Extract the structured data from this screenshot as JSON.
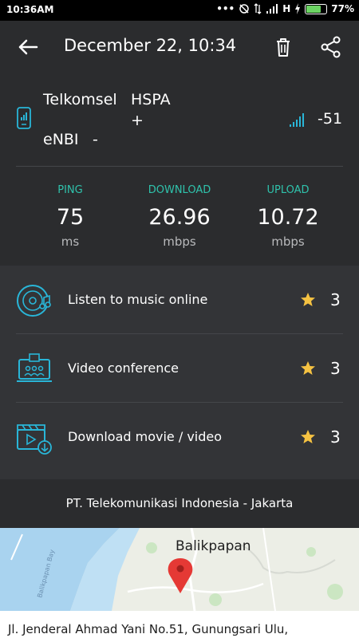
{
  "status_bar": {
    "time": "10:36AM",
    "network_type": "H",
    "battery_percent": "77%",
    "battery_level": 0.77
  },
  "header": {
    "title": "December 22, 10:34"
  },
  "network": {
    "carrier": "Telkomsel",
    "type": "HSPA",
    "plus": "+",
    "cell": "eNBI",
    "cell_value": "-",
    "signal": "-51"
  },
  "metrics": {
    "ping": {
      "label": "PING",
      "value": "75",
      "unit": "ms"
    },
    "download": {
      "label": "DOWNLOAD",
      "value": "26.96",
      "unit": "mbps"
    },
    "upload": {
      "label": "UPLOAD",
      "value": "10.72",
      "unit": "mbps"
    }
  },
  "activities": [
    {
      "label": "Listen to music online",
      "rating": "3",
      "icon": "music-disc-icon"
    },
    {
      "label": "Video conference",
      "rating": "3",
      "icon": "video-conference-icon"
    },
    {
      "label": "Download movie / video",
      "rating": "3",
      "icon": "download-video-icon"
    }
  ],
  "isp": "PT. Telekomunikasi Indonesia - Jakarta",
  "map": {
    "city": "Balikpapan",
    "bay_label": "Balikpapan Bay"
  },
  "address": "Jl. Jenderal Ahmad Yani No.51, Gunungsari Ulu,",
  "colors": {
    "accent": "#2fc3ac",
    "icon_blue": "#29b6d8",
    "star": "#f5c242",
    "background": "#2b2c2e",
    "card": "#333437"
  }
}
